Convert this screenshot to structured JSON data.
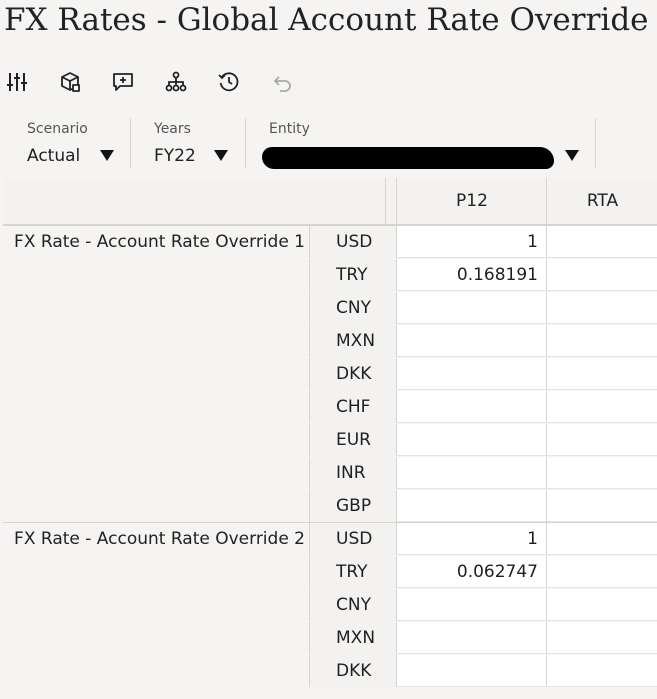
{
  "title": "FX Rates - Global Account Rate Override",
  "toolbar": {
    "icons": [
      "sliders-icon",
      "cube-icon",
      "add-comment-icon",
      "hierarchy-icon",
      "history-icon",
      "undo-icon"
    ]
  },
  "pov": {
    "scenario": {
      "label": "Scenario",
      "value": "Actual"
    },
    "years": {
      "label": "Years",
      "value": "FY22"
    },
    "entity": {
      "label": "Entity",
      "value": ""
    }
  },
  "grid": {
    "columns": [
      "P12",
      "RTA"
    ],
    "groups": [
      {
        "label": "FX Rate - Account Rate Override 1",
        "rows": [
          {
            "currency": "USD",
            "p12": "1",
            "rta": ""
          },
          {
            "currency": "TRY",
            "p12": "0.168191",
            "rta": ""
          },
          {
            "currency": "CNY",
            "p12": "",
            "rta": ""
          },
          {
            "currency": "MXN",
            "p12": "",
            "rta": ""
          },
          {
            "currency": "DKK",
            "p12": "",
            "rta": ""
          },
          {
            "currency": "CHF",
            "p12": "",
            "rta": ""
          },
          {
            "currency": "EUR",
            "p12": "",
            "rta": ""
          },
          {
            "currency": "INR",
            "p12": "",
            "rta": ""
          },
          {
            "currency": "GBP",
            "p12": "",
            "rta": ""
          }
        ]
      },
      {
        "label": "FX Rate - Account Rate Override 2",
        "rows": [
          {
            "currency": "USD",
            "p12": "1",
            "rta": ""
          },
          {
            "currency": "TRY",
            "p12": "0.062747",
            "rta": ""
          },
          {
            "currency": "CNY",
            "p12": "",
            "rta": ""
          },
          {
            "currency": "MXN",
            "p12": "",
            "rta": ""
          },
          {
            "currency": "DKK",
            "p12": "",
            "rta": ""
          }
        ]
      }
    ]
  }
}
